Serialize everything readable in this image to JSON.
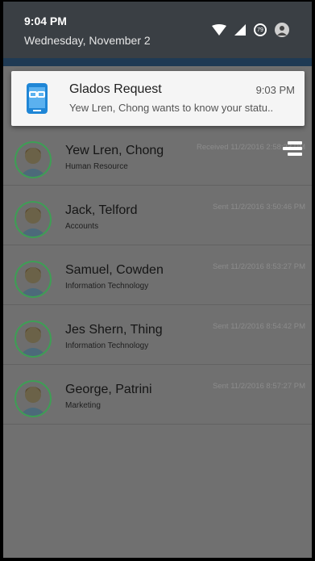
{
  "status": {
    "time": "9:04 PM",
    "date": "Wednesday, November 2",
    "icons": [
      "wifi-icon",
      "cellular-icon",
      "battery-icon",
      "profile-avatar"
    ],
    "battery_level": "79"
  },
  "notification": {
    "title": "Glados Request",
    "time": "9:03 PM",
    "text": "Yew Lren, Chong wants to know your statu.."
  },
  "contacts": [
    {
      "name": "Yew Lren, Chong",
      "dept": "Human Resource",
      "stamp": "Received 11/2/2016 2:58:23 PM"
    },
    {
      "name": "Jack, Telford",
      "dept": "Accounts",
      "stamp": "Sent 11/2/2016 3:50:46 PM"
    },
    {
      "name": "Samuel, Cowden",
      "dept": "Information Technology",
      "stamp": "Sent 11/2/2016 8:53:27 PM"
    },
    {
      "name": "Jes Shern, Thing",
      "dept": "Information Technology",
      "stamp": "Sent 11/2/2016 8:54:42 PM"
    },
    {
      "name": "George, Patrini",
      "dept": "Marketing",
      "stamp": "Sent 11/2/2016 8:57:27 PM"
    }
  ],
  "colors": {
    "accent_green": "#3e9e55",
    "overlay": "#707070",
    "shade": "#3a3f44",
    "app_bar": "#1f3a54"
  }
}
